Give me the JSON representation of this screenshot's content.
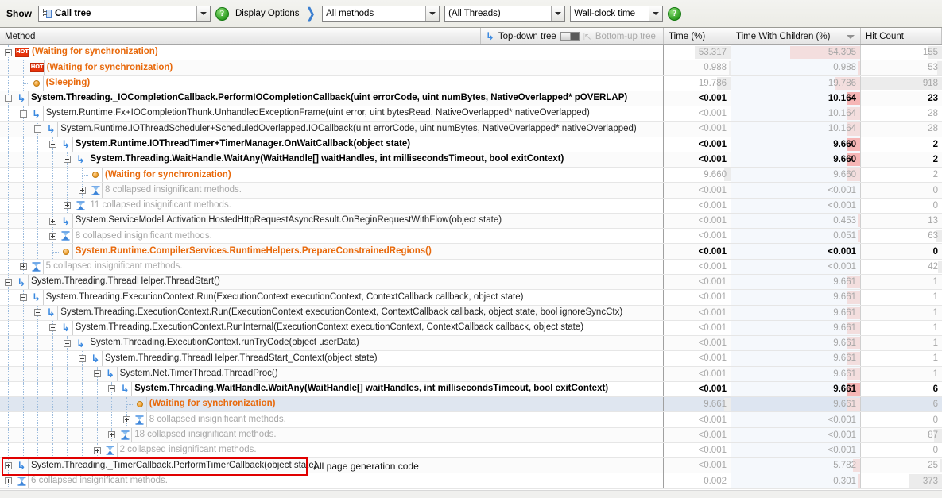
{
  "toolbar": {
    "show_label": "Show",
    "calltree_value": "Call tree",
    "calltree_icon": "call-tree-icon",
    "help_icon": "help-icon",
    "display_options_label": "Display Options",
    "chevron_icon": "double-chevron-right-icon",
    "methods_value": "All methods",
    "threads_value": "(All Threads)",
    "clock_value": "Wall-clock time",
    "help_icon_right": "help-icon"
  },
  "columns": {
    "method": "Method",
    "topdown": "Top-down tree",
    "bottomup": "Bottom-up tree",
    "time": "Time (%)",
    "time_with_children": "Time With Children (%)",
    "hit_count": "Hit Count"
  },
  "annotation": {
    "text": "All page generation code"
  },
  "rows": [
    {
      "depth": 0,
      "icon": "hot",
      "style": "orange",
      "text": "(Waiting for synchronization)",
      "expander": "minus",
      "time": "53.317",
      "time_bar": 53.3,
      "twc": "54.305",
      "twc_bar": 54.3,
      "hits": "155",
      "hit_bar": 17,
      "dim": true
    },
    {
      "depth": 1,
      "icon": "hot",
      "style": "orange",
      "text": "(Waiting for synchronization)",
      "expander": "none",
      "time": "0.988",
      "time_bar": 1.0,
      "twc": "0.988",
      "twc_bar": 1.0,
      "hits": "53",
      "hit_bar": 6,
      "dim": true
    },
    {
      "depth": 1,
      "icon": "dot",
      "style": "orange",
      "text": "(Sleeping)",
      "expander": "none",
      "time": "19.786",
      "time_bar": 19.8,
      "twc": "19.786",
      "twc_bar": 19.8,
      "hits": "918",
      "hit_bar": 100,
      "dim": true
    },
    {
      "depth": 0,
      "icon": "arrow",
      "style": "bold",
      "text": "System.Threading._IOCompletionCallback.PerformIOCompletionCallback(uint errorCode, uint numBytes, NativeOverlapped* pOVERLAP)",
      "expander": "minus",
      "time": "<0.001",
      "time_bar": 0,
      "twc": "10.164",
      "twc_bar": 10.2,
      "twc_strong": true,
      "hits": "23",
      "hit_bar": 0,
      "dim": false
    },
    {
      "depth": 1,
      "icon": "arrow",
      "style": "normal",
      "text": "System.Runtime.Fx+IOCompletionThunk.UnhandledExceptionFrame(uint error, uint bytesRead, NativeOverlapped* nativeOverlapped)",
      "expander": "minus",
      "time": "<0.001",
      "time_bar": 0,
      "twc": "10.164",
      "twc_bar": 10.2,
      "hits": "28",
      "hit_bar": 0,
      "dim": true
    },
    {
      "depth": 2,
      "icon": "arrow",
      "style": "normal",
      "text": "System.Runtime.IOThreadScheduler+ScheduledOverlapped.IOCallback(uint errorCode, uint numBytes, NativeOverlapped* nativeOverlapped)",
      "expander": "minus",
      "time": "<0.001",
      "time_bar": 0,
      "twc": "10.164",
      "twc_bar": 10.2,
      "hits": "28",
      "hit_bar": 0,
      "dim": true
    },
    {
      "depth": 3,
      "icon": "arrow",
      "style": "bold",
      "text": "System.Runtime.IOThreadTimer+TimerManager.OnWaitCallback(object state)",
      "expander": "minus",
      "time": "<0.001",
      "time_bar": 0,
      "twc": "9.660",
      "twc_bar": 9.7,
      "twc_strong": true,
      "hits": "2",
      "hit_bar": 0,
      "dim": false
    },
    {
      "depth": 4,
      "icon": "arrow",
      "style": "bold",
      "text": "System.Threading.WaitHandle.WaitAny(WaitHandle[] waitHandles, int millisecondsTimeout, bool exitContext)",
      "expander": "minus",
      "time": "<0.001",
      "time_bar": 0,
      "twc": "9.660",
      "twc_bar": 9.7,
      "twc_strong": true,
      "hits": "2",
      "hit_bar": 0,
      "dim": false
    },
    {
      "depth": 5,
      "icon": "dot",
      "style": "orange",
      "text": "(Waiting for synchronization)",
      "expander": "none",
      "time": "9.660",
      "time_bar": 9.7,
      "twc": "9.660",
      "twc_bar": 9.7,
      "hits": "2",
      "hit_bar": 0,
      "dim": true
    },
    {
      "depth": 5,
      "icon": "hour",
      "style": "gray",
      "text": "8 collapsed insignificant methods.",
      "expander": "plus",
      "time": "<0.001",
      "time_bar": 0,
      "twc": "<0.001",
      "twc_bar": 0,
      "hits": "0",
      "hit_bar": 0,
      "dim": true
    },
    {
      "depth": 4,
      "icon": "hour",
      "style": "gray",
      "text": "11 collapsed insignificant methods.",
      "expander": "plus",
      "time": "<0.001",
      "time_bar": 0,
      "twc": "<0.001",
      "twc_bar": 0,
      "hits": "0",
      "hit_bar": 0,
      "dim": true
    },
    {
      "depth": 3,
      "icon": "arrow",
      "style": "normal",
      "text": "System.ServiceModel.Activation.HostedHttpRequestAsyncResult.OnBeginRequestWithFlow(object state)",
      "expander": "plus",
      "time": "<0.001",
      "time_bar": 0,
      "twc": "0.453",
      "twc_bar": 0.5,
      "hits": "13",
      "hit_bar": 0,
      "dim": true
    },
    {
      "depth": 3,
      "icon": "hour",
      "style": "gray",
      "text": "8 collapsed insignificant methods.",
      "expander": "plus",
      "time": "<0.001",
      "time_bar": 0,
      "twc": "0.051",
      "twc_bar": 0.1,
      "hits": "63",
      "hit_bar": 7,
      "dim": true
    },
    {
      "depth": 3,
      "icon": "dot",
      "style": "orange",
      "text": "System.Runtime.CompilerServices.RuntimeHelpers.PrepareConstrainedRegions()",
      "expander": "none",
      "time": "<0.001",
      "time_bar": 0,
      "twc": "<0.001",
      "twc_bar": 0,
      "hits": "0",
      "hit_bar": 0,
      "dim": false
    },
    {
      "depth": 1,
      "icon": "hour",
      "style": "gray",
      "text": "5 collapsed insignificant methods.",
      "expander": "plus",
      "time": "<0.001",
      "time_bar": 0,
      "twc": "<0.001",
      "twc_bar": 0,
      "hits": "42",
      "hit_bar": 5,
      "dim": true
    },
    {
      "depth": 0,
      "icon": "arrow",
      "style": "normal",
      "text": "System.Threading.ThreadHelper.ThreadStart()",
      "expander": "minus",
      "time": "<0.001",
      "time_bar": 0,
      "twc": "9.661",
      "twc_bar": 9.7,
      "hits": "1",
      "hit_bar": 0,
      "dim": true
    },
    {
      "depth": 1,
      "icon": "arrow",
      "style": "normal",
      "text": "System.Threading.ExecutionContext.Run(ExecutionContext executionContext, ContextCallback callback, object state)",
      "expander": "minus",
      "time": "<0.001",
      "time_bar": 0,
      "twc": "9.661",
      "twc_bar": 9.7,
      "hits": "1",
      "hit_bar": 0,
      "dim": true
    },
    {
      "depth": 2,
      "icon": "arrow",
      "style": "normal",
      "text": "System.Threading.ExecutionContext.Run(ExecutionContext executionContext, ContextCallback callback, object state, bool ignoreSyncCtx)",
      "expander": "minus",
      "time": "<0.001",
      "time_bar": 0,
      "twc": "9.661",
      "twc_bar": 9.7,
      "hits": "1",
      "hit_bar": 0,
      "dim": true
    },
    {
      "depth": 3,
      "icon": "arrow",
      "style": "normal",
      "text": "System.Threading.ExecutionContext.RunInternal(ExecutionContext executionContext, ContextCallback callback, object state)",
      "expander": "minus",
      "time": "<0.001",
      "time_bar": 0,
      "twc": "9.661",
      "twc_bar": 9.7,
      "hits": "1",
      "hit_bar": 0,
      "dim": true
    },
    {
      "depth": 4,
      "icon": "arrow",
      "style": "normal",
      "text": "System.Threading.ExecutionContext.runTryCode(object userData)",
      "expander": "minus",
      "time": "<0.001",
      "time_bar": 0,
      "twc": "9.661",
      "twc_bar": 9.7,
      "hits": "1",
      "hit_bar": 0,
      "dim": true
    },
    {
      "depth": 5,
      "icon": "arrow",
      "style": "normal",
      "text": "System.Threading.ThreadHelper.ThreadStart_Context(object state)",
      "expander": "minus",
      "time": "<0.001",
      "time_bar": 0,
      "twc": "9.661",
      "twc_bar": 9.7,
      "hits": "1",
      "hit_bar": 0,
      "dim": true
    },
    {
      "depth": 6,
      "icon": "arrow",
      "style": "normal",
      "text": "System.Net.TimerThread.ThreadProc()",
      "expander": "minus",
      "time": "<0.001",
      "time_bar": 0,
      "twc": "9.661",
      "twc_bar": 9.7,
      "hits": "1",
      "hit_bar": 0,
      "dim": true
    },
    {
      "depth": 7,
      "icon": "arrow",
      "style": "bold",
      "text": "System.Threading.WaitHandle.WaitAny(WaitHandle[] waitHandles, int millisecondsTimeout, bool exitContext)",
      "expander": "minus",
      "time": "<0.001",
      "time_bar": 0,
      "twc": "9.661",
      "twc_bar": 9.7,
      "twc_strong": true,
      "hits": "6",
      "hit_bar": 0,
      "dim": false
    },
    {
      "depth": 8,
      "icon": "dot",
      "style": "orange",
      "text": "(Waiting for synchronization)",
      "expander": "none",
      "time": "9.661",
      "time_bar": 9.7,
      "twc": "9.661",
      "twc_bar": 9.7,
      "hits": "6",
      "hit_bar": 0,
      "dim": true,
      "selected": true
    },
    {
      "depth": 8,
      "icon": "hour",
      "style": "gray",
      "text": "8 collapsed insignificant methods.",
      "expander": "plus",
      "time": "<0.001",
      "time_bar": 0,
      "twc": "<0.001",
      "twc_bar": 0,
      "hits": "0",
      "hit_bar": 0,
      "dim": true
    },
    {
      "depth": 7,
      "icon": "hour",
      "style": "gray",
      "text": "18 collapsed insignificant methods.",
      "expander": "plus",
      "time": "<0.001",
      "time_bar": 0,
      "twc": "<0.001",
      "twc_bar": 0,
      "hits": "87",
      "hit_bar": 10,
      "dim": true
    },
    {
      "depth": 6,
      "icon": "hour",
      "style": "gray",
      "text": "2 collapsed insignificant methods.",
      "expander": "plus",
      "time": "<0.001",
      "time_bar": 0,
      "twc": "<0.001",
      "twc_bar": 0,
      "hits": "0",
      "hit_bar": 0,
      "dim": true
    },
    {
      "depth": 0,
      "icon": "arrow",
      "style": "normal",
      "text": "System.Threading._TimerCallback.PerformTimerCallback(object state)",
      "expander": "plus",
      "time": "<0.001",
      "time_bar": 0,
      "twc": "5.782",
      "twc_bar": 5.8,
      "hits": "25",
      "hit_bar": 3,
      "dim": true,
      "annotated": true
    },
    {
      "depth": 0,
      "icon": "hour",
      "style": "gray",
      "text": "6 collapsed insignificant methods.",
      "expander": "plus",
      "time": "0.002",
      "time_bar": 0,
      "twc": "0.301",
      "twc_bar": 0.3,
      "hits": "373",
      "hit_bar": 41,
      "dim": true
    }
  ]
}
